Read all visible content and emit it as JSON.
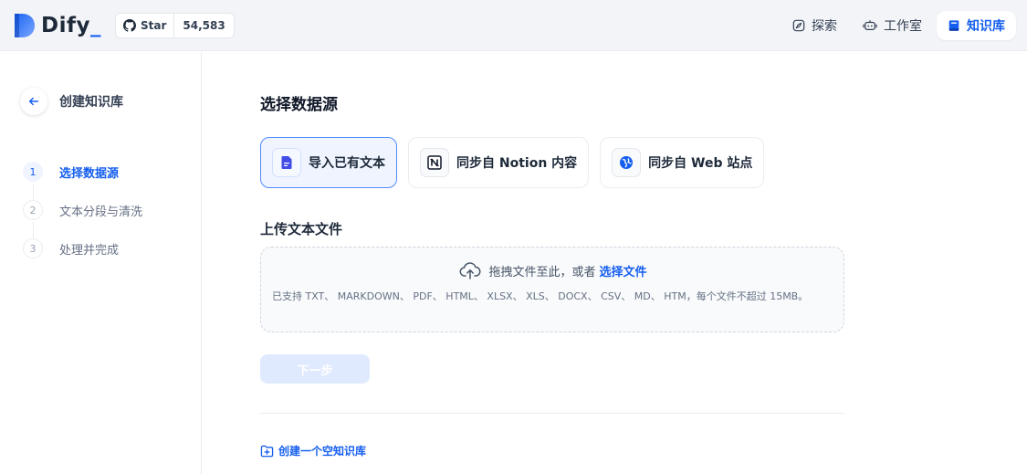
{
  "header": {
    "logo_text": "Dify",
    "logo_suffix": "_",
    "github_label": "Star",
    "github_count": "54,583",
    "nav": [
      {
        "label": "探索",
        "icon": "compass-icon",
        "active": false
      },
      {
        "label": "工作室",
        "icon": "robot-icon",
        "active": false
      },
      {
        "label": "知识库",
        "icon": "book-icon",
        "active": true
      }
    ]
  },
  "sidebar": {
    "title": "创建知识库",
    "steps": [
      {
        "num": "1",
        "label": "选择数据源",
        "active": true
      },
      {
        "num": "2",
        "label": "文本分段与清洗",
        "active": false
      },
      {
        "num": "3",
        "label": "处理并完成",
        "active": false
      }
    ]
  },
  "main": {
    "title": "选择数据源",
    "sources": [
      {
        "label": "导入已有文本",
        "icon": "file-text-icon",
        "active": true
      },
      {
        "label": "同步自 Notion 内容",
        "icon": "notion-icon",
        "active": false
      },
      {
        "label": "同步自 Web 站点",
        "icon": "globe-icon",
        "active": false
      }
    ],
    "upload_title": "上传文本文件",
    "dropzone": {
      "text": "拖拽文件至此，或者",
      "link": "选择文件",
      "tip": "已支持 TXT、 MARKDOWN、 PDF、 HTML、 XLSX、 XLS、 DOCX、 CSV、 MD、 HTM，每个文件不超过 15MB。"
    },
    "next_label": "下一步",
    "empty_link": "创建一个空知识库"
  },
  "colors": {
    "accent": "#155eef",
    "accent_light": "#eff4ff",
    "disabled_button": "#e0eaff"
  }
}
